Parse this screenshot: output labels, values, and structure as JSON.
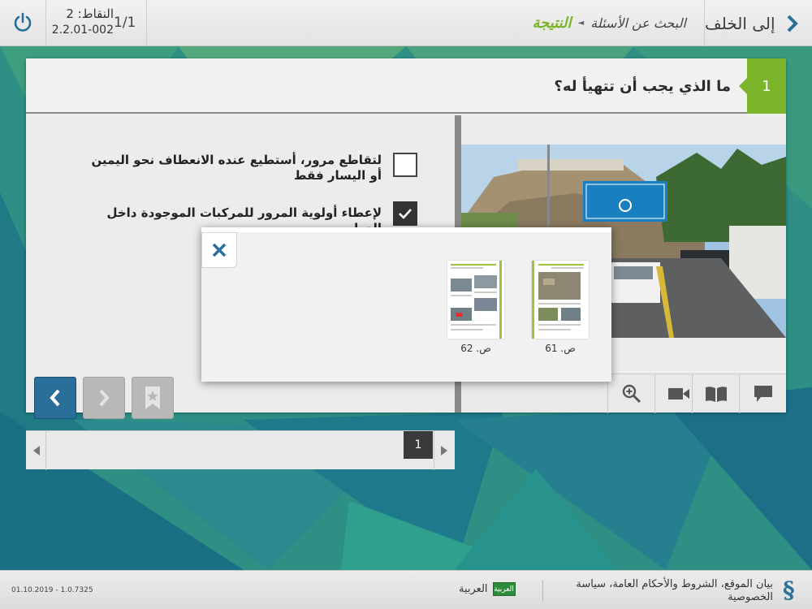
{
  "header": {
    "back_label": "إلى الخلف",
    "breadcrumb_search": "البحث عن الأسئلة",
    "breadcrumb_result": "النتيجة",
    "points_label": "النقاط: 2",
    "question_code": "2.2.01-002",
    "counter": "1/1"
  },
  "question": {
    "number": "1",
    "text": "ما الذي يجب أن تتهيأ له؟",
    "answers": [
      {
        "text": "لتقاطع مرور، أستطيع عنده الانعطاف نحو اليمين أو اليسار فقط",
        "checked": false
      },
      {
        "text": "لإعطاء أولوية المرور للمركبات الموجودة داخل الدوار",
        "checked": true
      }
    ]
  },
  "pager": {
    "current_page": "1"
  },
  "tools": {
    "icons": [
      "zoom-icon",
      "video-icon",
      "book-icon",
      "comment-icon"
    ]
  },
  "modal": {
    "pages": [
      {
        "label": "ص. 61"
      },
      {
        "label": "ص. 62"
      }
    ]
  },
  "footer": {
    "links": "بيان الموقع، الشروط والأحكام العامة، سياسة الخصوصية",
    "language_badge": "العربية",
    "language_name": "العربية",
    "version": "01.10.2019 - 1.0.7325"
  },
  "colors": {
    "accent_green": "#7cb52a",
    "nav_blue": "#2a6e9a",
    "background_teal": "#2e8f84"
  }
}
